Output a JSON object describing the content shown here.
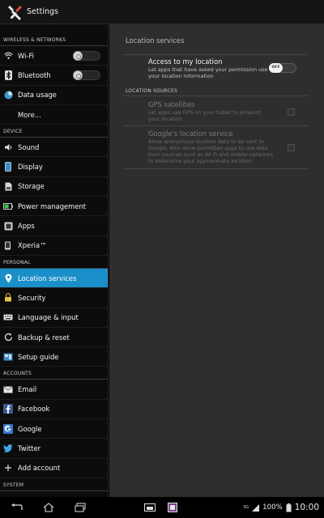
{
  "header": {
    "title": "Settings",
    "icon": "settings-tools-icon"
  },
  "sidebar": {
    "sections": [
      {
        "header": "WIRELESS & NETWORKS",
        "items": [
          {
            "label": "Wi-Fi",
            "icon": "wifi-icon",
            "toggle": true
          },
          {
            "label": "Bluetooth",
            "icon": "bluetooth-icon",
            "toggle": true
          },
          {
            "label": "Data usage",
            "icon": "data-usage-icon"
          },
          {
            "label": "More...",
            "icon": ""
          }
        ]
      },
      {
        "header": "DEVICE",
        "items": [
          {
            "label": "Sound",
            "icon": "speaker-icon"
          },
          {
            "label": "Display",
            "icon": "display-icon"
          },
          {
            "label": "Storage",
            "icon": "storage-icon"
          },
          {
            "label": "Power management",
            "icon": "battery-icon"
          },
          {
            "label": "Apps",
            "icon": "apps-icon"
          },
          {
            "label": "Xperia™",
            "icon": "xperia-icon"
          }
        ]
      },
      {
        "header": "PERSONAL",
        "items": [
          {
            "label": "Location services",
            "icon": "location-pin-icon",
            "active": true
          },
          {
            "label": "Security",
            "icon": "lock-icon"
          },
          {
            "label": "Language & input",
            "icon": "keyboard-icon"
          },
          {
            "label": "Backup & reset",
            "icon": "backup-icon"
          },
          {
            "label": "Setup guide",
            "icon": "setup-guide-icon"
          }
        ]
      },
      {
        "header": "ACCOUNTS",
        "items": [
          {
            "label": "Email",
            "icon": "email-icon"
          },
          {
            "label": "Facebook",
            "icon": "facebook-icon"
          },
          {
            "label": "Google",
            "icon": "google-icon"
          },
          {
            "label": "Twitter",
            "icon": "twitter-icon"
          },
          {
            "label": "Add account",
            "icon": "plus-icon"
          }
        ]
      },
      {
        "header": "SYSTEM",
        "items": []
      }
    ]
  },
  "content": {
    "title": "Location services",
    "access": {
      "title": "Access to my location",
      "summary": "Let apps that have asked your permission use your location information",
      "toggle_label": "OFF"
    },
    "category": "LOCATION SOURCES",
    "gps": {
      "title": "GPS satellites",
      "summary": "Let apps use GPS on your tablet to pinpoint your location"
    },
    "google": {
      "title": "Google's location service",
      "summary": "Allow anonymous location data to be sent to Google. Also allow permitted apps to use data from sources such as Wi-Fi and mobile networks to determine your approximate location."
    }
  },
  "statusbar": {
    "network": "3G",
    "battery": "100%",
    "time": "10:00"
  },
  "colors": {
    "accent": "#1a8fc9",
    "content_bg": "#2e2e2e",
    "sidebar_bg": "#0c0c0c"
  }
}
